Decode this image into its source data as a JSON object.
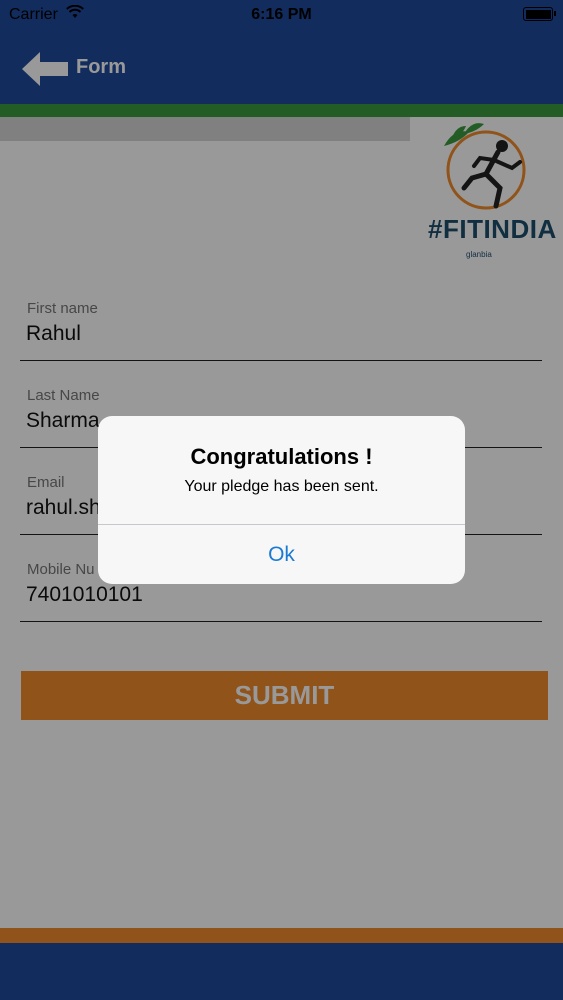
{
  "status_bar": {
    "carrier": "Carrier",
    "time": "6:16 PM"
  },
  "nav": {
    "title": "Form"
  },
  "logo": {
    "text": "#FITINDIA",
    "brand": "glanbia"
  },
  "form": {
    "fields": [
      {
        "label": "First name",
        "value": "Rahul"
      },
      {
        "label": "Last Name",
        "value": "Sharma"
      },
      {
        "label": "Email",
        "value": "rahul.sh"
      },
      {
        "label": "Mobile Nu",
        "value": "7401010101"
      }
    ],
    "submit_label": "SUBMIT"
  },
  "alert": {
    "title": "Congratulations !",
    "message": "Your pledge has been sent.",
    "ok_label": "Ok"
  },
  "colors": {
    "nav_blue": "#1f4a9c",
    "accent_orange": "#f08a2c",
    "accent_green": "#3b9a3e",
    "link_blue": "#1a7ad4"
  }
}
